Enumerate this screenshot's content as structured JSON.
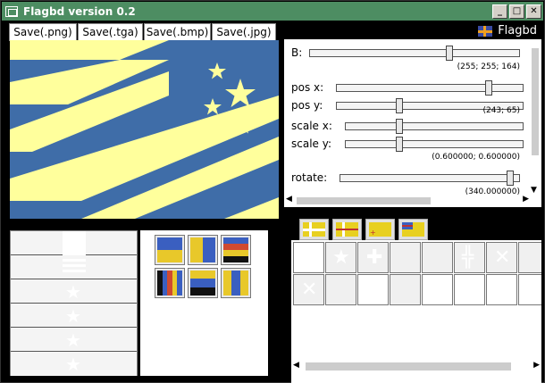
{
  "window": {
    "title": "Flagbd version 0.2"
  },
  "save_buttons": [
    {
      "label": "Save(.png)"
    },
    {
      "label": "Save(.tga)"
    },
    {
      "label": "Save(.bmp)"
    },
    {
      "label": "Save(.jpg)"
    }
  ],
  "panel": {
    "title": "Flagbd"
  },
  "sliders": {
    "b_label": "B:",
    "color_readout": "(255; 255; 164)",
    "posx_label": "pos  x:",
    "posy_label": "pos  y:",
    "pos_readout": "(243; 65)",
    "scalex_label": "scale x:",
    "scaley_label": "scale y:",
    "scale_readout": "(0.600000; 0.600000)",
    "rotate_label": "rotate:",
    "rotate_readout": "(340.000000)"
  },
  "colors": {
    "flag_background": "#3f6da8",
    "stripe": "#ffff9c",
    "titlebar": "#4d8d62"
  }
}
